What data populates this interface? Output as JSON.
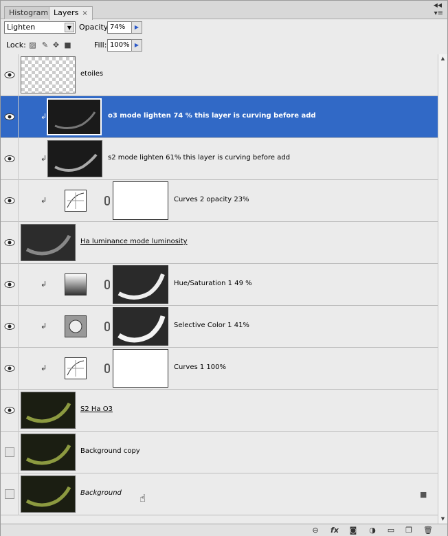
{
  "tabs": [
    {
      "label": "Histogram",
      "active": false
    },
    {
      "label": "Layers",
      "active": true,
      "close": "×"
    }
  ],
  "blend_mode": {
    "value": "Lighten"
  },
  "opacity": {
    "label": "Opacity:",
    "value": "74%"
  },
  "lock": {
    "label": "Lock:",
    "icons": [
      "lock-transparent-icon",
      "lock-image-icon",
      "lock-position-icon",
      "lock-all-icon"
    ]
  },
  "fill": {
    "label": "Fill:",
    "value": "100%"
  },
  "layers": [
    {
      "name": "etoiles",
      "visible": true
    },
    {
      "name": "o3 mode lighten 74 % this layer is curving before add",
      "visible": true,
      "selected": true
    },
    {
      "name": "s2 mode lighten 61% this layer is curving before add",
      "visible": true
    },
    {
      "name": "Curves 2 opacity 23%",
      "visible": true
    },
    {
      "name": "Ha luminance mode luminosity",
      "visible": true
    },
    {
      "name": "Hue/Saturation 1 49 %",
      "visible": true
    },
    {
      "name": "Selective Color 1 41%",
      "visible": true
    },
    {
      "name": "Curves 1 100%",
      "visible": true
    },
    {
      "name": "S2 Ha O3",
      "visible": true
    },
    {
      "name": "Background copy",
      "visible": false
    },
    {
      "name": "Background",
      "visible": false,
      "locked": true
    }
  ],
  "footer_icons": [
    "link-layers-icon",
    "fx-icon",
    "add-mask-icon",
    "adjustment-layer-icon",
    "new-group-icon",
    "new-layer-icon",
    "delete-layer-icon"
  ],
  "colors": {
    "selection": "#3169c6",
    "panel": "#ebebeb"
  }
}
